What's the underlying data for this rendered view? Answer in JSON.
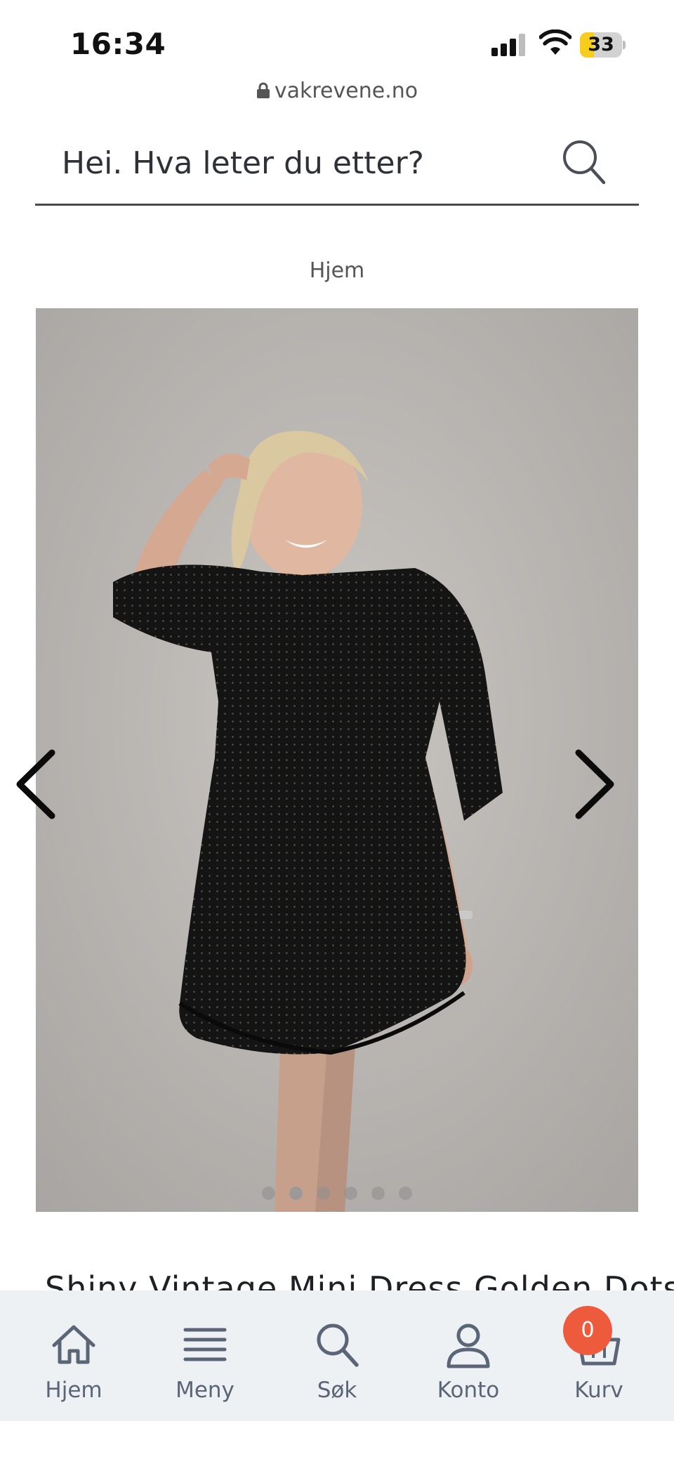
{
  "status": {
    "time": "16:34",
    "battery": "33"
  },
  "browser": {
    "url": "vakrevene.no"
  },
  "search": {
    "placeholder": "Hei. Hva leter du etter?"
  },
  "breadcrumb": {
    "home": "Hjem"
  },
  "product": {
    "title": "Shiny Vintage Mini Dress Golden Dots",
    "image_alt": "Woman in black mini dress with golden dots",
    "image_count": 6,
    "active_image": 2
  },
  "nav": {
    "items": [
      {
        "label": "Hjem",
        "icon": "home-icon"
      },
      {
        "label": "Meny",
        "icon": "menu-icon"
      },
      {
        "label": "Søk",
        "icon": "search-icon"
      },
      {
        "label": "Konto",
        "icon": "account-icon"
      },
      {
        "label": "Kurv",
        "icon": "basket-icon"
      }
    ],
    "cart_count": "0"
  },
  "colors": {
    "badge": "#ee5a3c",
    "nav_bg": "#eef1f3",
    "nav_text": "#5a6577",
    "battery_fill": "#f6cd1c"
  }
}
